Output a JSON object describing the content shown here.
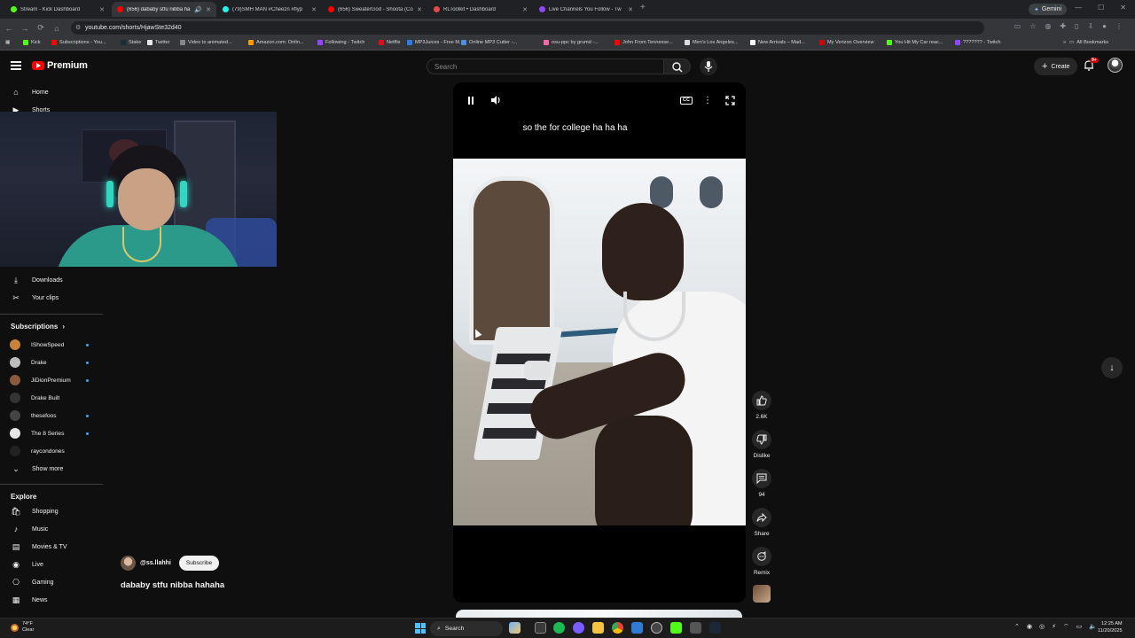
{
  "browser": {
    "tabs": [
      {
        "label": "Stream - Kick Dashboard",
        "color": "#53fc18",
        "active": false
      },
      {
        "label": "(656) dababy stfu nibba ha",
        "color": "#ff0000",
        "active": true
      },
      {
        "label": "(79)SMH MAN #Cheezn #flyp",
        "color": "#25f4ee",
        "active": false
      },
      {
        "label": "(656) SweaterGod - Shoota (Co",
        "color": "#ff0000",
        "active": false
      },
      {
        "label": "RLToolkit • Dashboard",
        "color": "#e8484a",
        "active": false
      },
      {
        "label": "Live Channels You Follow - Tw",
        "color": "#9146ff",
        "active": false
      }
    ],
    "gemini_label": "Gemini",
    "url": "youtube.com/shorts/HjawSte32d40",
    "bookmarks": [
      {
        "label": "Kick",
        "color": "#53fc18"
      },
      {
        "label": "Subscriptions - You...",
        "color": "#ff0000"
      },
      {
        "label": "Stake",
        "color": "#1a2c38"
      },
      {
        "label": "Twitter",
        "color": "#e7e9ea"
      },
      {
        "label": "Video to animated...",
        "color": "#888888"
      },
      {
        "label": "Amazon.com: Onlin...",
        "color": "#ff9900"
      },
      {
        "label": "Following - Twitch",
        "color": "#9146ff"
      },
      {
        "label": "Netflix",
        "color": "#e50914"
      },
      {
        "label": "MP3Juices - Free M...",
        "color": "#2b7de9"
      },
      {
        "label": "Online MP3 Cutter -...",
        "color": "#4a90e2"
      },
      {
        "label": "osu-ppc by grumd -...",
        "color": "#ff66aa"
      },
      {
        "label": "John From Tennesse...",
        "color": "#ff0000"
      },
      {
        "label": "Men's Los Angeles...",
        "color": "#dddddd"
      },
      {
        "label": "New Arrivals – Mad...",
        "color": "#ffffff"
      },
      {
        "label": "My Verizon Overview",
        "color": "#cd040b"
      },
      {
        "label": "You Hit My Car reac...",
        "color": "#53fc18"
      },
      {
        "label": "??????? - Twitch",
        "color": "#9146ff"
      }
    ],
    "all_bookmarks": "All Bookmarks"
  },
  "youtube": {
    "brand": "Premium",
    "search_placeholder": "Search",
    "create_label": "Create",
    "notif_count": "9+"
  },
  "sidebar": {
    "top_items": [
      {
        "label": "Home"
      },
      {
        "label": "Shorts"
      }
    ],
    "you_items": [
      {
        "label": "Downloads"
      },
      {
        "label": "Your clips"
      }
    ],
    "subscriptions_heading": "Subscriptions",
    "subscriptions": [
      {
        "name": "IShowSpeed",
        "color": "#c8833b",
        "new": true
      },
      {
        "name": "Drake",
        "color": "#bcbcbc",
        "new": true
      },
      {
        "name": "JiDionPremium",
        "color": "#8a5a3c",
        "new": true
      },
      {
        "name": "Drake Built",
        "color": "#333333",
        "new": false
      },
      {
        "name": "thesefoos",
        "color": "#444444",
        "new": true
      },
      {
        "name": "The 8 Series",
        "color": "#e6e6e6",
        "new": true
      },
      {
        "name": "raycondones",
        "color": "#222222",
        "new": false
      }
    ],
    "show_more": "Show more",
    "explore_heading": "Explore",
    "explore_items": [
      {
        "label": "Shopping"
      },
      {
        "label": "Music"
      },
      {
        "label": "Movies & TV"
      },
      {
        "label": "Live"
      },
      {
        "label": "Gaming"
      },
      {
        "label": "News"
      }
    ]
  },
  "short": {
    "caption": "so the for college ha ha ha",
    "channel": "@ss.llahhi",
    "subscribe_label": "Subscribe",
    "title": "dababy stfu nibba hahaha",
    "actions": {
      "likes": "2.6K",
      "dislike": "Dislike",
      "comments": "94",
      "share": "Share",
      "remix": "Remix"
    }
  },
  "taskbar": {
    "weather_temp": "74°F",
    "weather_desc": "Clear",
    "search_label": "Search",
    "time": "12:25 AM",
    "date": "11/20/2025"
  }
}
